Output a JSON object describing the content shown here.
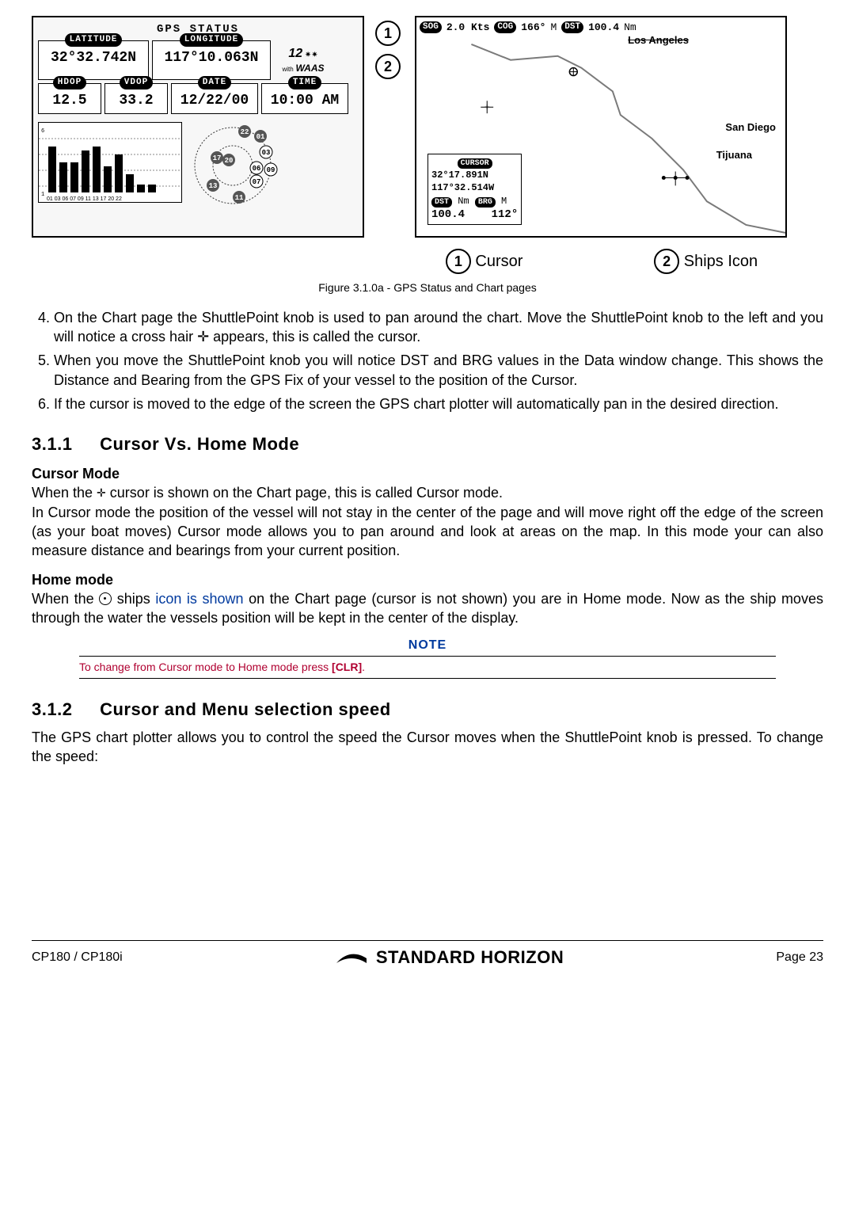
{
  "gps_panel": {
    "title": "GPS STATUS",
    "latitude": {
      "label": "LATITUDE",
      "value": "32°32.742N"
    },
    "longitude": {
      "label": "LONGITUDE",
      "value": "117°10.063N"
    },
    "waas": {
      "n": "12",
      "with": "with",
      "txt": "WAAS"
    },
    "hdop": {
      "label": "HDOP",
      "value": "12.5"
    },
    "vdop": {
      "label": "VDOP",
      "value": "33.2"
    },
    "date": {
      "label": "DATE",
      "value": "12/22/00"
    },
    "time": {
      "label": "TIME",
      "value": "10:00 AM"
    },
    "sat_nums": [
      "01",
      "03",
      "06",
      "07",
      "09",
      "11",
      "13",
      "17",
      "20",
      "22"
    ]
  },
  "chart_panel": {
    "status": {
      "sog_label": "SOG",
      "sog_value": "2.0 Kts",
      "cog_label": "COG",
      "cog_value": "166°",
      "cog_unit": "M",
      "dst_label": "DST",
      "dst_value": "100.4",
      "dst_unit": "Nm"
    },
    "map_labels": {
      "la": "Los Angeles",
      "sd": "San Diego",
      "tj": "Tijuana"
    },
    "cursor_box": {
      "title": "CURSOR",
      "lat": "32°17.891N",
      "lon": "117°32.514W",
      "dst_label": "DST",
      "dst_unit": "Nm",
      "brg_label": "BRG",
      "brg_unit": "M",
      "dst_value": "100.4",
      "brg_value": "112°"
    }
  },
  "legend": {
    "item1_num": "1",
    "item1_label": "Cursor",
    "item2_num": "2",
    "item2_label": "Ships Icon"
  },
  "fig_caption": "Figure 3.1.0a - GPS Status and Chart pages",
  "steps": {
    "s4": "On the Chart page the ShuttlePoint knob is used to pan around the chart. Move the ShuttlePoint knob to the left and you will notice a cross hair ✛ appears, this is called the cursor.",
    "s5": "When you move the ShuttlePoint knob you will notice DST and BRG values in the Data window change. This shows the Distance and Bearing from the GPS Fix of your vessel to the position of the Cursor.",
    "s6": "If the cursor is moved to the edge of the screen the GPS chart plotter will automatically pan in the desired direction."
  },
  "sec311": {
    "num": "3.1.1",
    "title": "Cursor Vs. Home Mode",
    "cursor_mode_head": "Cursor Mode",
    "cursor_line1a": "When the ",
    "cursor_line1b": " cursor is shown on the Chart page, this is called Cursor mode.",
    "cursor_para": "In Cursor mode the position of the vessel will not stay in the center of the page and will move right off the edge of the screen (as your boat moves) Cursor mode allows you to pan around and look at areas on the map. In this mode your can also measure distance and bearings from your current position.",
    "home_mode_head": "Home mode",
    "home_line_a": "When the ",
    "home_line_b": " ships",
    "home_line_blue": " icon is shown",
    "home_line_c": " on the Chart page (cursor is not shown) you are in Home mode. Now as the ship moves through the water the vessels position will be kept in the center of the display."
  },
  "note": {
    "title": "NOTE",
    "body_a": "To change from Cursor mode to Home mode press ",
    "body_b": "[CLR]",
    "body_c": "."
  },
  "sec312": {
    "num": "3.1.2",
    "title": "Cursor and Menu selection speed",
    "para": "The GPS chart plotter allows you to control the speed the Cursor moves when the ShuttlePoint knob is pressed. To change the speed:"
  },
  "footer": {
    "left": "CP180 / CP180i",
    "brand": "STANDARD HORIZON",
    "right": "Page 23"
  }
}
